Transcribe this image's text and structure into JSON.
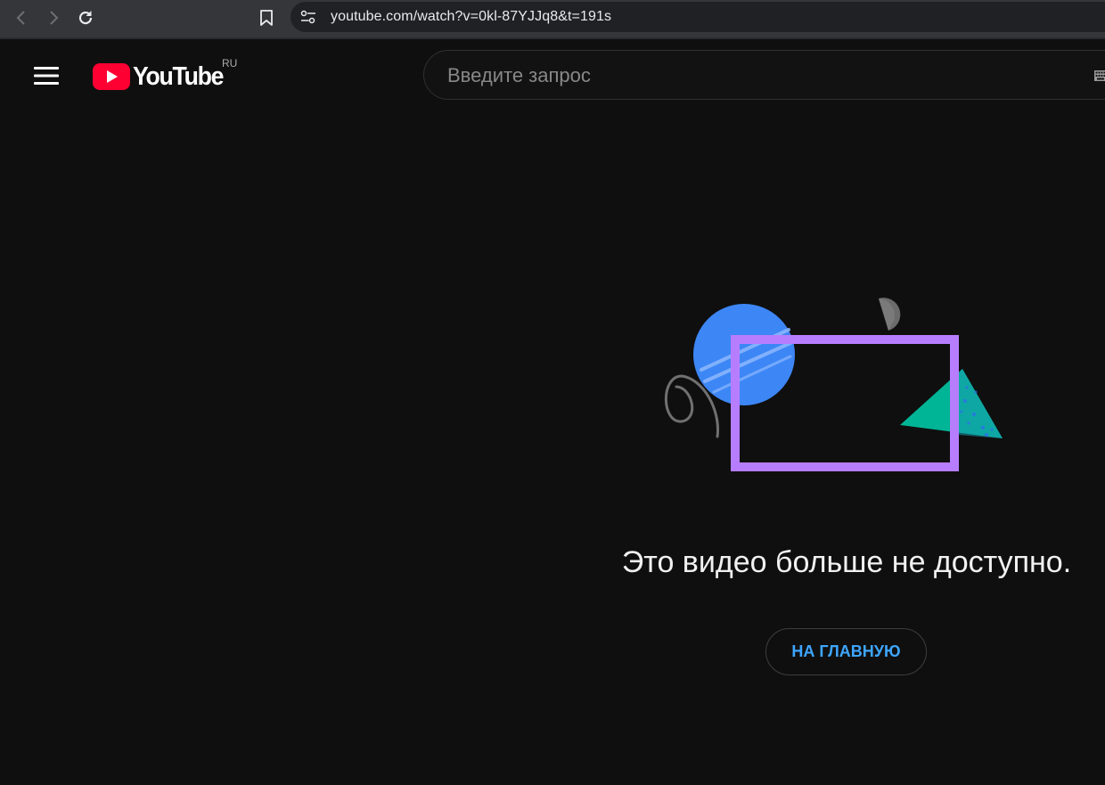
{
  "browser": {
    "url": "youtube.com/watch?v=0kl-87YJJq8&t=191s",
    "icons": [
      "back-icon",
      "forward-icon",
      "reload-icon",
      "bookmark-icon",
      "site-info-icon"
    ]
  },
  "header": {
    "logo_text": "YouTube",
    "region": "RU",
    "search_placeholder": "Введите запрос",
    "search_value": "",
    "icons": [
      "menu-icon",
      "youtube-logo-icon",
      "keyboard-icon"
    ]
  },
  "error": {
    "message": "Это видео больше не доступно.",
    "home_button_label": "НА ГЛАВНУЮ"
  },
  "colors": {
    "background": "#0f0f0f",
    "brand_red": "#ff0033",
    "link_blue": "#3ea6ff",
    "frame_purple": "#b77dff",
    "circle_blue": "#3d86f5",
    "triangle_teal": "#00b596"
  }
}
